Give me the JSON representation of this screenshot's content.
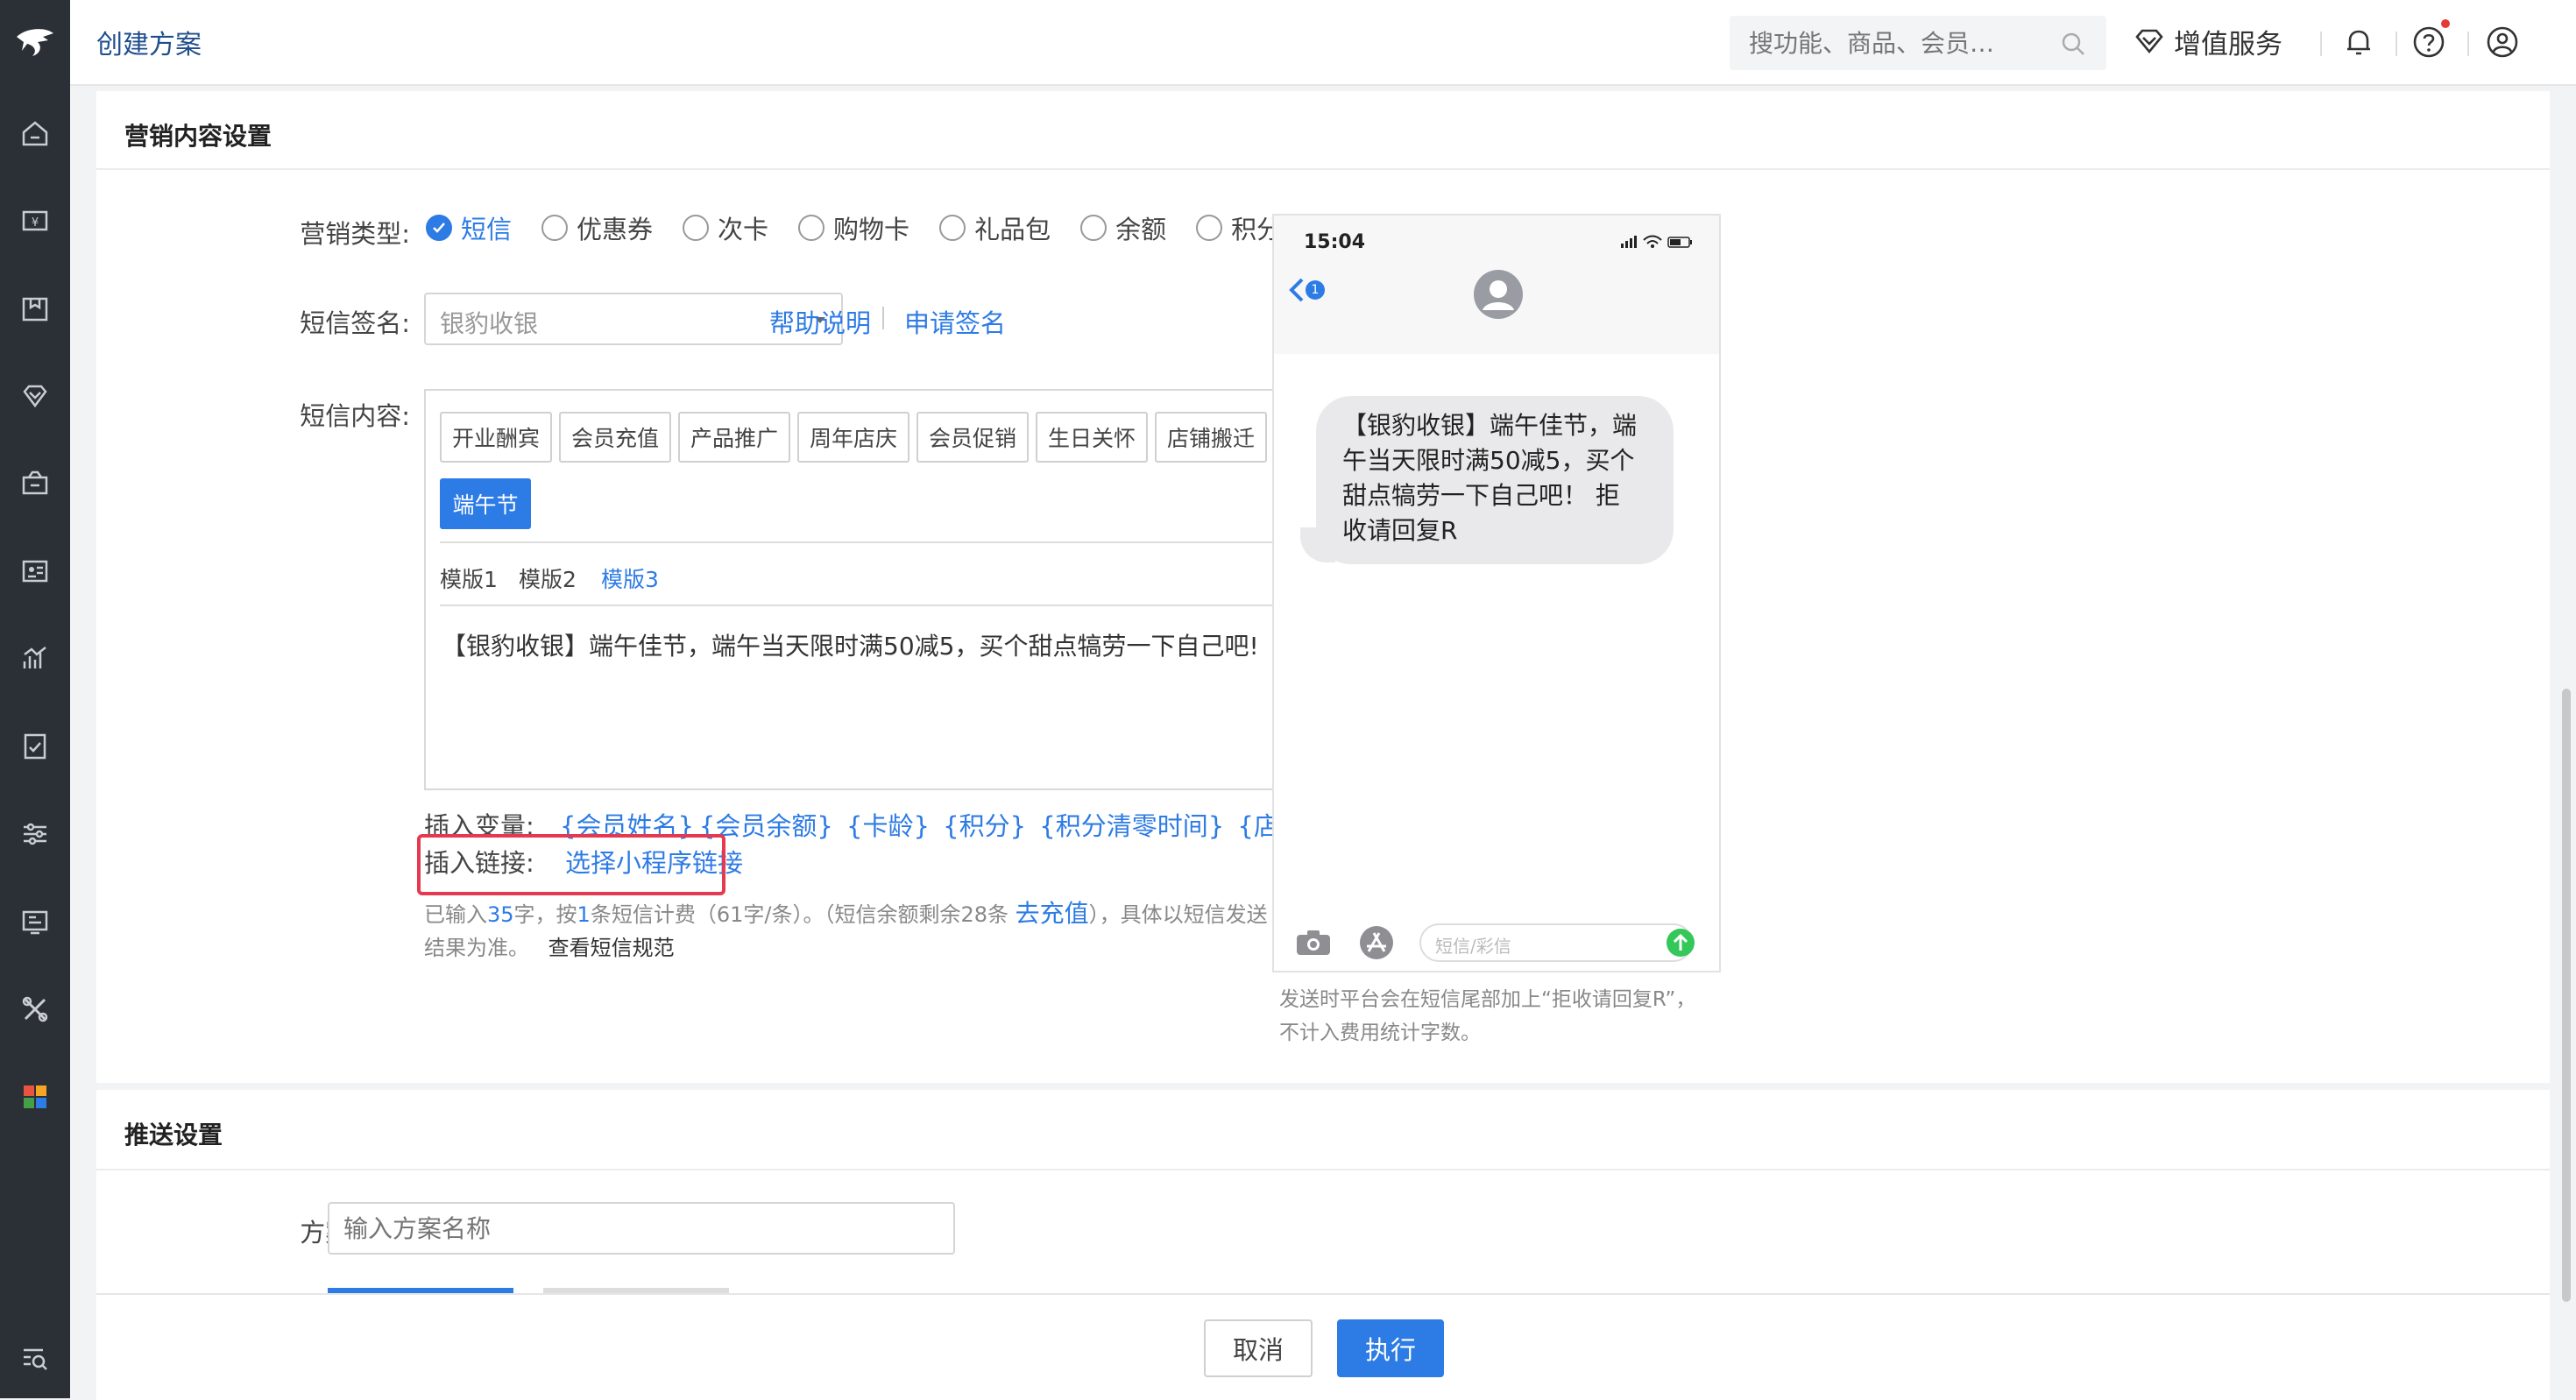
{
  "header": {
    "title": "创建方案",
    "search_placeholder": "搜功能、商品、会员…",
    "value_added_service": "增值服务"
  },
  "marketing": {
    "section_title": "营销内容设置",
    "type_label": "营销类型:",
    "types": [
      "短信",
      "优惠券",
      "次卡",
      "购物卡",
      "礼品包",
      "余额",
      "积分"
    ],
    "selected_type": "短信",
    "signature_label": "短信签名:",
    "signature_value": "银豹收银",
    "help_link": "帮助说明",
    "apply_link": "申请签名",
    "content_label": "短信内容:",
    "templates": [
      "开业酬宾",
      "会员充值",
      "产品推广",
      "周年店庆",
      "会员促销",
      "生日关怀",
      "店铺搬迁",
      "端午节"
    ],
    "active_template": "端午节",
    "versions": [
      "模版1",
      "模版2",
      "模版3"
    ],
    "active_version": "模版3",
    "sms_text": "【银豹收银】端午佳节，端午当天限时满50减5，买个甜点犒劳一下自己吧!",
    "insert_var_label": "插入变量:",
    "variables": [
      "{会员姓名}",
      "{会员余额}",
      "{卡龄}",
      "{积分}",
      "{积分清零时间}",
      "{店铺名称}"
    ],
    "insert_link_label": "插入链接:",
    "insert_link_action": "选择小程序链接",
    "stats_prefix": "已输入",
    "stats_count": "35",
    "stats_mid": "字，按",
    "stats_msgs": "1",
    "stats_rest": "条短信计费（61字/条）。（短信余额剩余28条",
    "recharge_link": "去充值",
    "stats_tail": "），具体以短信发送",
    "stats_line2": "结果为准。",
    "rules_link": "查看短信规范"
  },
  "preview": {
    "time": "15:04",
    "back_count": "1",
    "bubble_lines": [
      "【银豹收银】端午佳节，端",
      "午当天限时满50减5，买个",
      "甜点犒劳一下自己吧！ 拒",
      "收请回复R"
    ],
    "input_placeholder": "短信/彩信",
    "note_line1": "发送时平台会在短信尾部加上“拒收请回复R”，",
    "note_line2": "不计入费用统计字数。"
  },
  "push": {
    "section_title": "推送设置",
    "plan_name_label": "方案名称:",
    "plan_name_placeholder": "输入方案名称"
  },
  "footer": {
    "cancel": "取消",
    "execute": "执行"
  },
  "colors": {
    "accent": "#2d7be5",
    "sidebar": "#2b2f36",
    "highlight": "#e53950"
  }
}
